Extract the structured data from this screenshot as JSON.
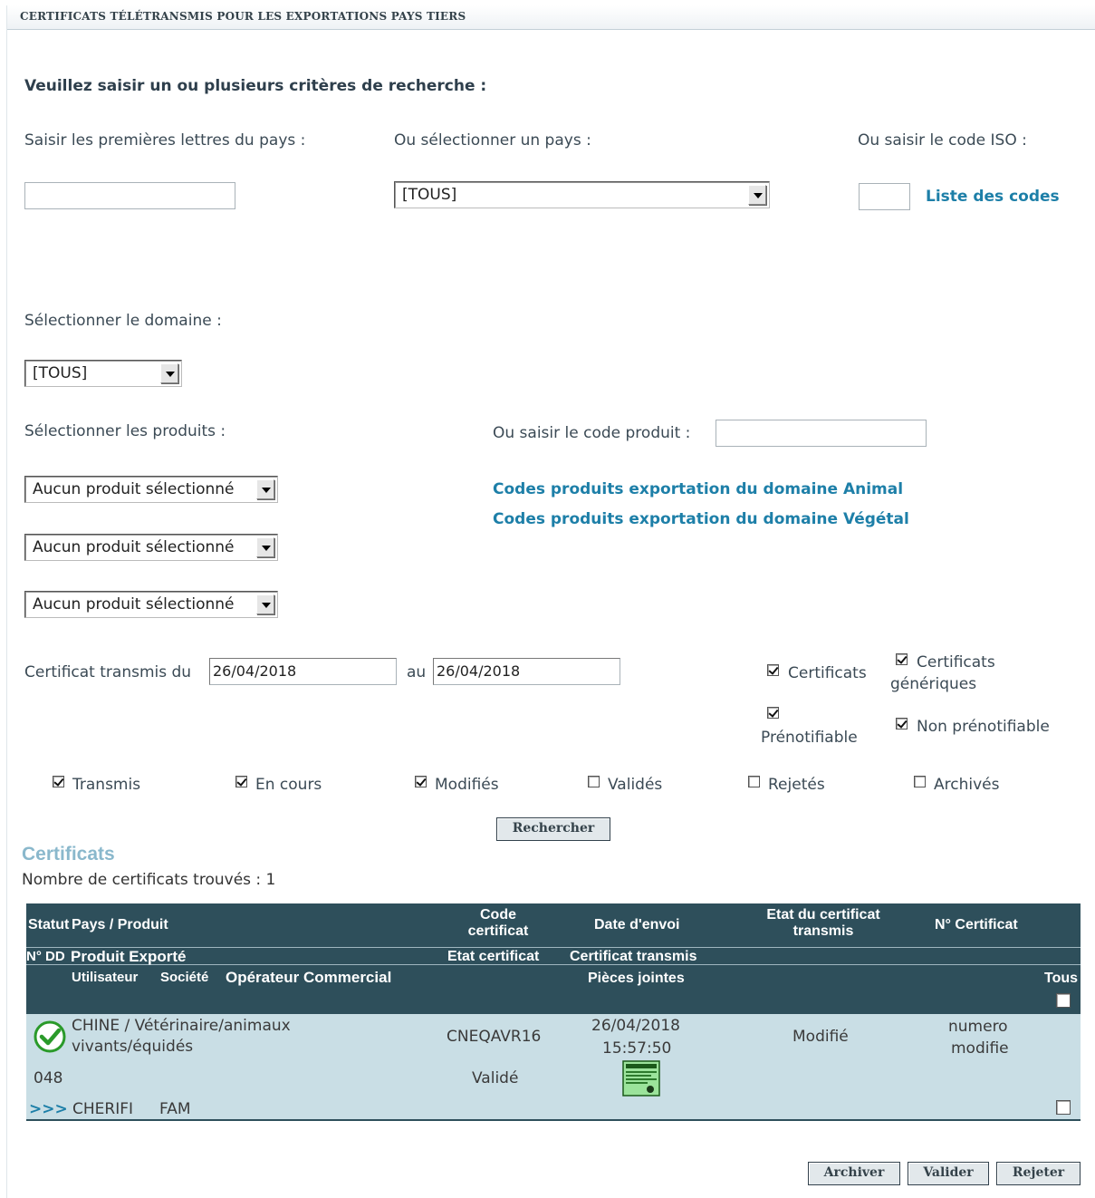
{
  "header": {
    "title": "CERTIFICATS TÉLÉTRANSMIS POUR LES EXPORTATIONS PAYS TIERS"
  },
  "search": {
    "heading": "Veuillez saisir un ou plusieurs critères de recherche  :",
    "country_letters_label": "Saisir les premières lettres du pays :",
    "country_select_label": "Ou sélectionner un pays :",
    "country_select_value": "[TOUS]",
    "iso_label": "Ou saisir le code ISO :",
    "codes_list_link": "Liste des codes",
    "domain_label": "Sélectionner le domaine :",
    "domain_value": "[TOUS]",
    "products_label": "Sélectionner les produits :",
    "product_code_label": "Ou saisir le code produit :",
    "product_selects": [
      "Aucun produit sélectionné",
      "Aucun produit sélectionné",
      "Aucun produit sélectionné"
    ],
    "link_animal": "Codes produits exportation du domaine Animal",
    "link_vegetal": "Codes produits exportation du domaine Végétal",
    "date_from_label": "Certificat transmis du",
    "date_from": "26/04/2018",
    "date_to_label": "au",
    "date_to": "26/04/2018",
    "type_checks": {
      "certificats": "Certificats",
      "generiques_1": "Certificats",
      "generiques_2": "génériques",
      "prenotifiable": "Prénotifiable",
      "non_prenotifiable": "Non prénotifiable"
    },
    "status_checks": [
      {
        "label": "Transmis",
        "checked": true
      },
      {
        "label": "En cours",
        "checked": true
      },
      {
        "label": "Modifiés",
        "checked": true
      },
      {
        "label": "Validés",
        "checked": false
      },
      {
        "label": "Rejetés",
        "checked": false
      },
      {
        "label": "Archivés",
        "checked": false
      }
    ],
    "search_button": "Rechercher"
  },
  "results": {
    "title": "Certificats",
    "count_text": "Nombre de certificats trouvés : 1",
    "headers": {
      "statut": "Statut",
      "pays_produit": "Pays / Produit",
      "code_certificat": "Code certificat",
      "date_envoi": "Date d'envoi",
      "etat_transmis": "Etat du certificat transmis",
      "numero": "N° Certificat",
      "ndd": "N° DD",
      "produit_exporte": "Produit Exporté",
      "etat_certificat": "Etat certificat",
      "certificat_transmis": "Certificat transmis",
      "utilisateur": "Utilisateur",
      "societe": "Société",
      "operateur": "Opérateur Commercial",
      "pieces": "Pièces jointes",
      "tous": "Tous"
    },
    "row": {
      "pays_line1": "CHINE / Vétérinaire/animaux",
      "pays_line2": "vivants/équidés",
      "code": "CNEQAVR16",
      "date": "26/04/2018",
      "time": "15:57:50",
      "etat": "Modifié",
      "numero_line1": "numero",
      "numero_line2": "modifie",
      "ndd": "048",
      "etat_certificat": "Validé",
      "arrows": ">>>",
      "utilisateur": "CHERIFI",
      "societe": "FAM"
    }
  },
  "actions": {
    "archive": "Archiver",
    "validate": "Valider",
    "reject": "Rejeter"
  },
  "colors": {
    "table_header": "#2e4f5b",
    "row_bg": "#c9dee5",
    "link": "#1d7fa8",
    "section_title": "#8ab8cc"
  }
}
